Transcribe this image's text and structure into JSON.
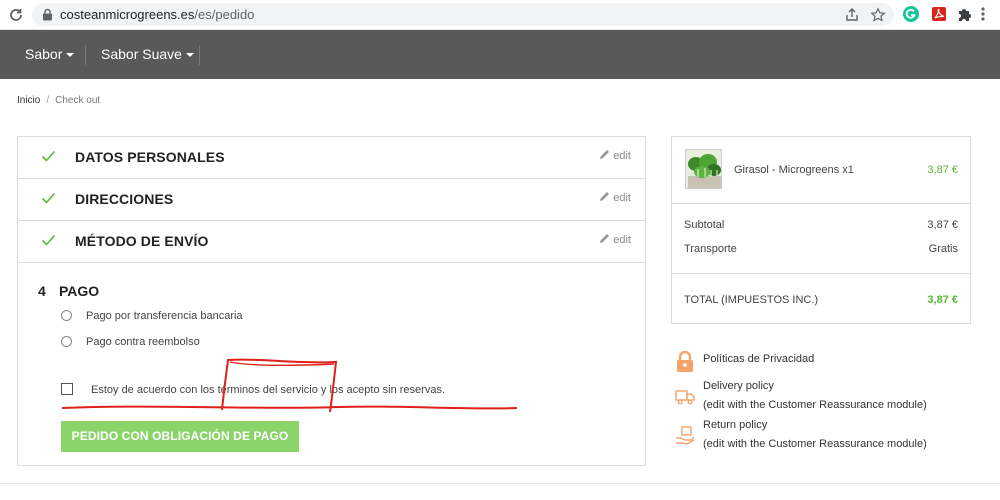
{
  "browser": {
    "url_host": "costeanmicrogreens.es",
    "url_path": "/es/pedido"
  },
  "nav": {
    "items": [
      {
        "label": "Sabor"
      },
      {
        "label": "Sabor Suave"
      }
    ]
  },
  "breadcrumb": {
    "home": "Inicio",
    "separator": "/",
    "current": "Check out"
  },
  "checkout": {
    "steps": [
      {
        "title": "DATOS PERSONALES",
        "edit": "edit"
      },
      {
        "title": "DIRECCIONES",
        "edit": "edit"
      },
      {
        "title": "MÉTODO DE ENVÍO",
        "edit": "edit"
      }
    ],
    "payment": {
      "number": "4",
      "title": "PAGO",
      "options": [
        {
          "label": "Pago por transferencia bancaria"
        },
        {
          "label": "Pago contra reembolso"
        }
      ],
      "terms": "Estoy de acuerdo con los términos del servicio y los acepto sin reservas.",
      "order_button": "PEDIDO CON OBLIGACIÓN DE PAGO"
    }
  },
  "summary": {
    "product_name": "Girasol - Microgreens x1",
    "product_price": "3,87 €",
    "subtotal_label": "Subtotal",
    "subtotal_value": "3,87 €",
    "shipping_label": "Transporte",
    "shipping_value": "Gratis",
    "total_label": "TOTAL (IMPUESTOS INC.)",
    "total_value": "3,87 €"
  },
  "reassurance": [
    {
      "line1": "Políticas de Privacidad",
      "line2": ""
    },
    {
      "line1": "Delivery policy",
      "line2": "(edit with the Customer Reassurance module)"
    },
    {
      "line1": "Return policy",
      "line2": "(edit with the Customer Reassurance module)"
    }
  ],
  "colors": {
    "nav_bg": "#595959",
    "accent_green": "#58b836",
    "button_green": "#8bd46a",
    "reassurance_orange": "#f5a36b",
    "annotation_red": "#e0201a"
  }
}
